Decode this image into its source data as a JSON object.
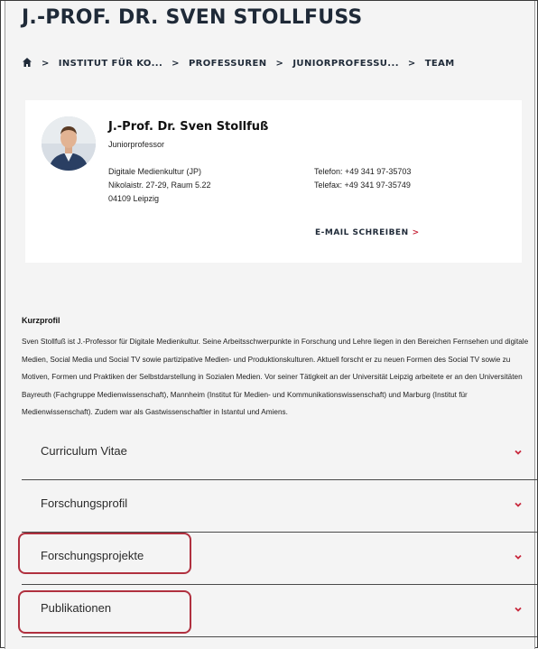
{
  "page": {
    "title": "J.-PROF. DR. SVEN STOLLFUSS"
  },
  "breadcrumb": {
    "items": [
      "INSTITUT FÜR KO...",
      "PROFESSUREN",
      "JUNIORPROFESSU...",
      "TEAM"
    ],
    "separator": ">"
  },
  "profile": {
    "name": "J.-Prof. Dr. Sven Stollfuß",
    "role": "Juniorprofessor",
    "address": [
      "Digitale Medienkultur (JP)",
      "Nikolaistr. 27-29, Raum 5.22",
      "04109 Leipzig"
    ],
    "phone": "Telefon: +49 341 97-35703",
    "fax": "Telefax: +49 341 97-35749",
    "email_label": "E-MAIL SCHREIBEN",
    "email_arrow": ">"
  },
  "kurzprofil": {
    "heading": "Kurzprofil",
    "text": "Sven Stollfuß ist J.-Professor für Digitale Medienkultur. Seine Arbeitsschwerpunkte in Forschung und Lehre liegen in den Bereichen Fernsehen und digitale Medien, Social Media und Social TV sowie partizipative Medien- und Produktionskulturen. Aktuell forscht er zu neuen Formen des Social TV sowie zu Motiven, Formen und Praktiken der Selbstdarstellung in Sozialen Medien. Vor seiner Tätigkeit an der Universität Leipzig arbeitete er an den Universitäten Bayreuth (Fachgruppe Medienwissenschaft), Mannheim (Institut für Medien- und Kommunikationswissenschaft) und Marburg (Institut für Medienwissenschaft). Zudem war als Gastwissenschaftler in Istantul und Amiens."
  },
  "accordion": {
    "items": [
      {
        "label": "Curriculum Vitae",
        "highlighted": false
      },
      {
        "label": "Forschungsprofil",
        "highlighted": false
      },
      {
        "label": "Forschungsprojekte",
        "highlighted": true
      },
      {
        "label": "Publikationen",
        "highlighted": true
      }
    ]
  },
  "colors": {
    "accent": "#c8283c",
    "highlight_border": "#b0303f",
    "title": "#1f2a38",
    "background": "#f4f4f4"
  },
  "icons": {
    "home": "home-icon",
    "chevron": "chevron-down-icon"
  }
}
